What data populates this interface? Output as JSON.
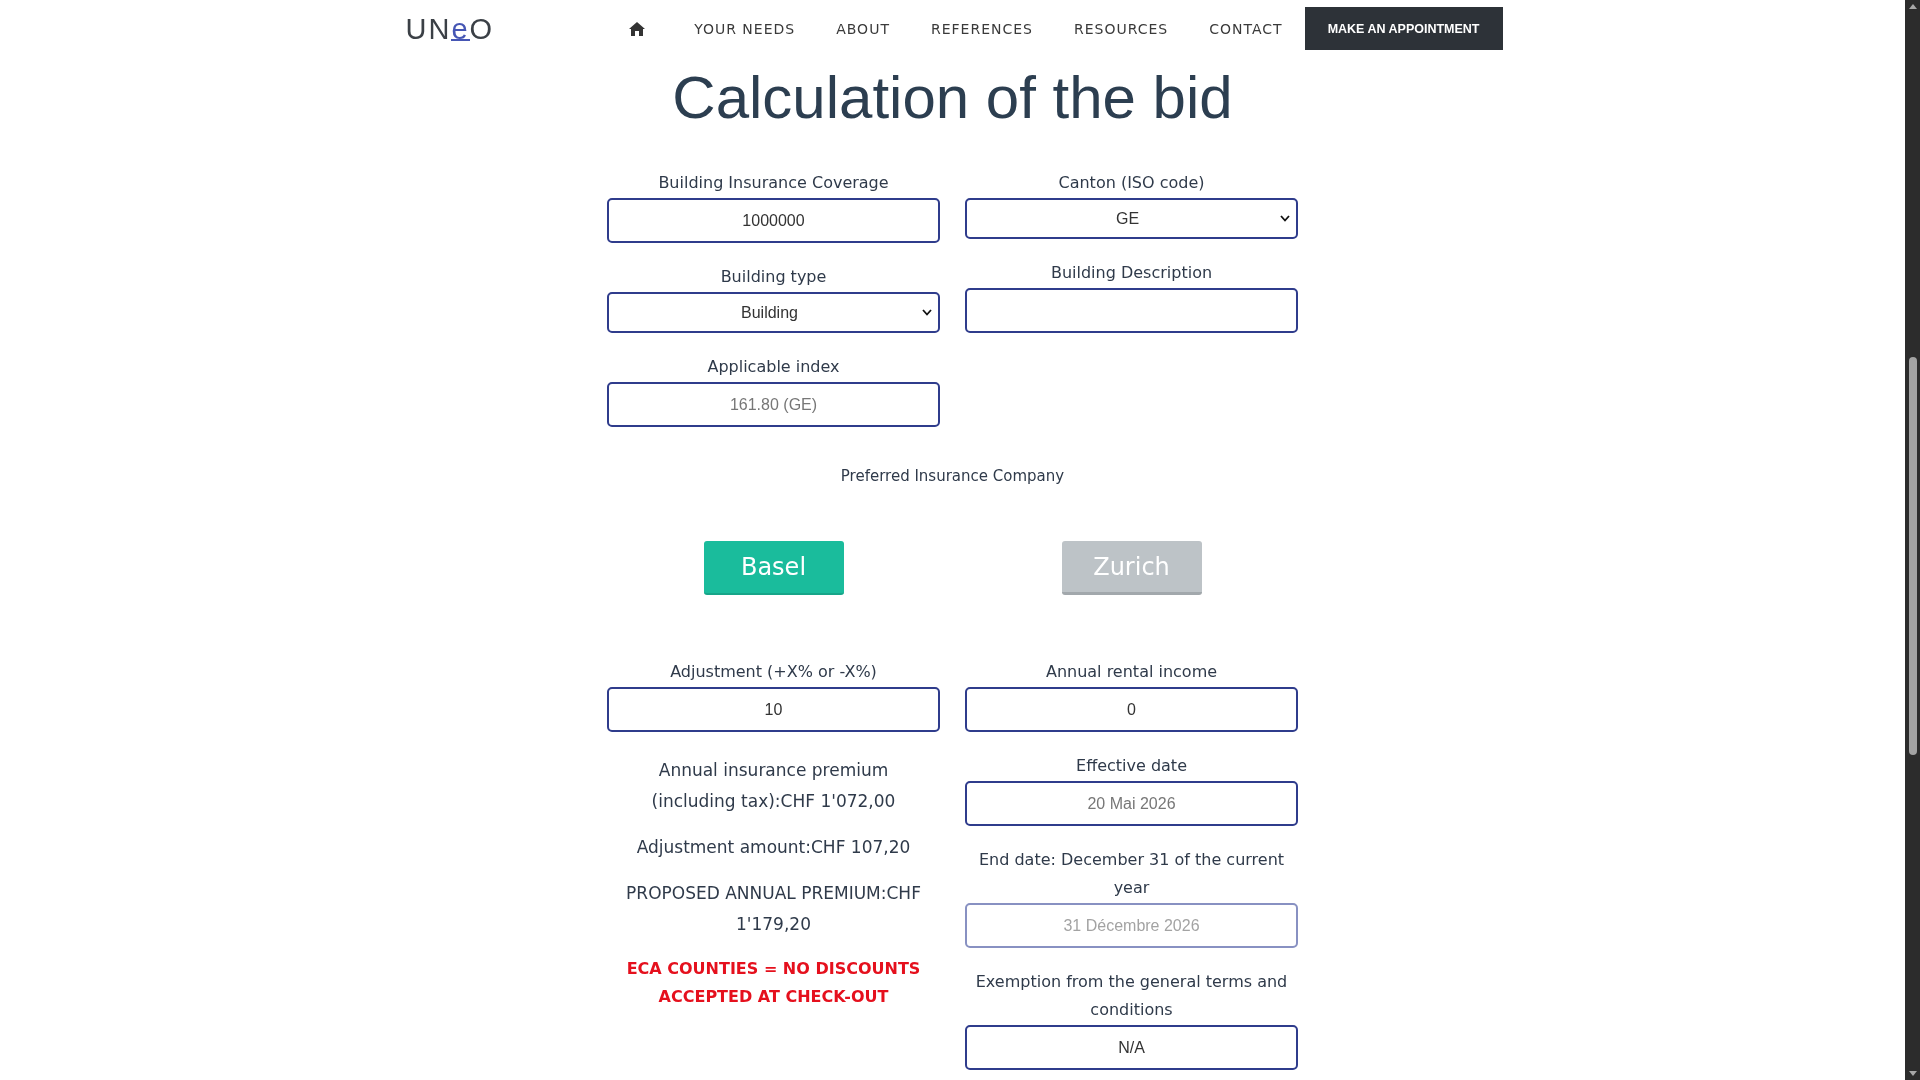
{
  "header": {
    "logo": {
      "lead": "UN",
      "accent": "e",
      "trail": "O"
    },
    "nav": [
      "YOUR NEEDS",
      "ABOUT",
      "REFERENCES",
      "RESOURCES",
      "CONTACT"
    ],
    "cta": "MAKE AN APPOINTMENT"
  },
  "title": "Calculation of the bid",
  "property": {
    "left": [
      {
        "label": "Building Insurance Coverage",
        "kind": "input",
        "value": "1000000",
        "disabled": false
      },
      {
        "label": "Building type",
        "kind": "select",
        "value": "Building",
        "disabled": false
      },
      {
        "label": "Applicable index",
        "kind": "input",
        "placeholder": "161.80 (GE)",
        "disabled": false
      }
    ],
    "right": [
      {
        "label": "Canton (ISO code)",
        "kind": "select",
        "value": "GE",
        "disabled": false
      },
      {
        "label": "Building Description",
        "kind": "input",
        "disabled": false
      }
    ]
  },
  "insurer": {
    "label": "Preferred Insurance Company",
    "options": [
      {
        "label": "Basel",
        "selected": true
      },
      {
        "label": "Zurich",
        "selected": false
      }
    ]
  },
  "pricing": {
    "left": {
      "fields": [
        {
          "label": "Adjustment (+X% or -X%)",
          "kind": "input",
          "value": "10",
          "disabled": false
        }
      ],
      "summary": [
        "Annual insurance premium (including tax):CHF 1'072,00",
        "Adjustment amount:CHF 107,20",
        "PROPOSED ANNUAL PREMIUM:CHF 1'179,20"
      ],
      "notice": "ECA COUNTIES = NO DISCOUNTS ACCEPTED AT CHECK-OUT"
    },
    "right": {
      "fields": [
        {
          "label": "Annual rental income",
          "kind": "input",
          "value": "0",
          "disabled": false
        },
        {
          "label": "Effective date",
          "kind": "input",
          "placeholder": "20 Mai 2026",
          "disabled": false
        },
        {
          "label": "End date: December 31 of the current year",
          "kind": "input",
          "placeholder": "31 Décembre 2026",
          "disabled": true
        },
        {
          "label": "Exemption from the general terms and conditions",
          "kind": "input",
          "value": "N/A",
          "disabled": false
        }
      ]
    }
  }
}
